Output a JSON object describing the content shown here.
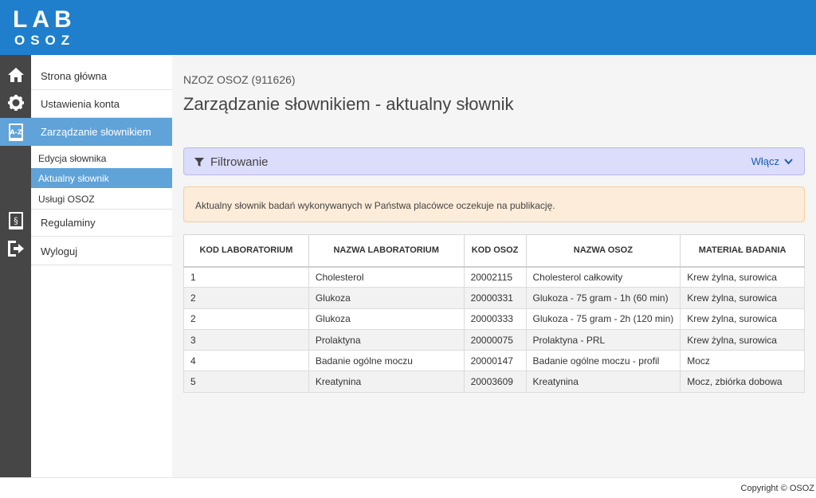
{
  "header": {
    "logo_top": "LAB",
    "logo_bottom": "OSOZ",
    "color": "#1f7fcc"
  },
  "iconbar": [
    {
      "icon": "home-icon"
    },
    {
      "icon": "gear-icon"
    },
    {
      "icon": "dictionary-icon",
      "label": "A-Z"
    },
    {
      "icon": "regulations-icon",
      "label": "§"
    },
    {
      "icon": "logout-icon"
    }
  ],
  "sidebar": {
    "items": [
      {
        "label": "Strona główna"
      },
      {
        "label": "Ustawienia konta"
      },
      {
        "label": "Zarządzanie słownikiem"
      },
      {
        "label": "Regulaminy"
      },
      {
        "label": "Wyloguj"
      }
    ],
    "subitems": [
      {
        "label": "Edycja słownika"
      },
      {
        "label": "Aktualny słownik"
      },
      {
        "label": "Usługi OSOZ"
      }
    ],
    "active_color": "#5fa3d9"
  },
  "main": {
    "org": "NZOZ OSOZ (911626)",
    "title": "Zarządzanie słownikiem - aktualny słownik",
    "filter": {
      "label": "Filtrowanie",
      "toggle": "Włącz"
    },
    "alert": "Aktualny słownik badań wykonywanych w Państwa placówce oczekuje na publikację.",
    "table": {
      "columns": [
        "KOD LABORATORIUM",
        "NAZWA LABORATORIUM",
        "KOD OSOZ",
        "NAZWA OSOZ",
        "MATERIAŁ BADANIA"
      ],
      "rows": [
        [
          "1",
          "Cholesterol",
          "20002115",
          "Cholesterol całkowity",
          "Krew żylna, surowica"
        ],
        [
          "2",
          "Glukoza",
          "20000331",
          "Glukoza - 75 gram - 1h (60 min)",
          "Krew żylna, surowica"
        ],
        [
          "2",
          "Glukoza",
          "20000333",
          "Glukoza - 75 gram - 2h (120 min)",
          "Krew żylna, surowica"
        ],
        [
          "3",
          "Prolaktyna",
          "20000075",
          "Prolaktyna - PRL",
          "Krew żylna, surowica"
        ],
        [
          "4",
          "Badanie ogólne moczu",
          "20000147",
          "Badanie ogólne moczu - profil",
          "Mocz"
        ],
        [
          "5",
          "Kreatynina",
          "20003609",
          "Kreatynina",
          "Mocz, zbiórka dobowa"
        ]
      ]
    }
  },
  "footer": {
    "copyright": "Copyright © OSOZ"
  }
}
